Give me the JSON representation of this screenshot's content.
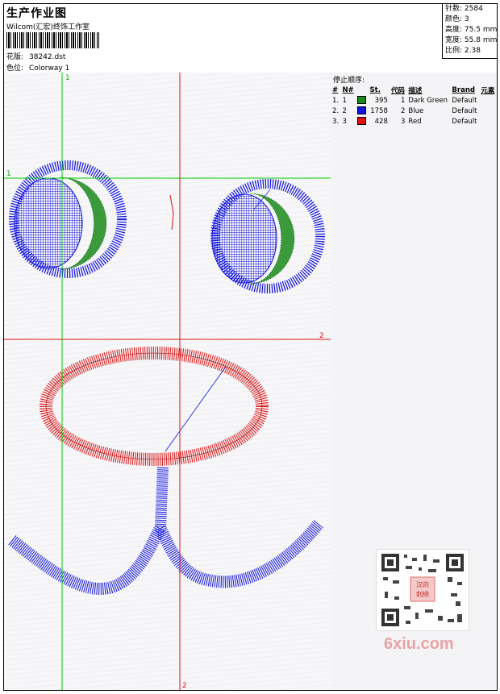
{
  "header": {
    "title": "生产作业图",
    "company": "Wilcom(汇宏)终饰工作室",
    "file_label": "花版:",
    "file_value": "38242.dst",
    "colorway_label": "色位:",
    "colorway_value": "Colorway 1"
  },
  "stats": [
    {
      "label": "针数:",
      "value": "2584"
    },
    {
      "label": "颜色:",
      "value": "3"
    },
    {
      "label": "高度:",
      "value": "75.5 mm"
    },
    {
      "label": "宽度:",
      "value": "55.8 mm"
    },
    {
      "label": "比例:",
      "value": "2.38"
    }
  ],
  "stop_sequence": {
    "title": "停止顺序:",
    "headers": [
      "#",
      "N#",
      "St.",
      "代码",
      "描述",
      "Brand",
      "元素"
    ],
    "rows": [
      {
        "num": "1.",
        "n": "1",
        "color": "#1a8a1a",
        "st": "395",
        "code": "1",
        "desc": "Dark Green",
        "brand": "Default"
      },
      {
        "num": "2.",
        "n": "2",
        "color": "#1010e0",
        "st": "1758",
        "code": "2",
        "desc": "Blue",
        "brand": "Default"
      },
      {
        "num": "3.",
        "n": "3",
        "color": "#e01010",
        "st": "428",
        "code": "3",
        "desc": "Red",
        "brand": "Default"
      }
    ]
  },
  "guides": {
    "green_v": "1",
    "green_h": "1",
    "red_h": "2",
    "red_v": "2"
  },
  "watermark": {
    "qr_text": "汉的刺绣",
    "site": "6xiu.com"
  },
  "colors": {
    "green": "#1a8a1a",
    "blue": "#1010e0",
    "red": "#e01010"
  }
}
